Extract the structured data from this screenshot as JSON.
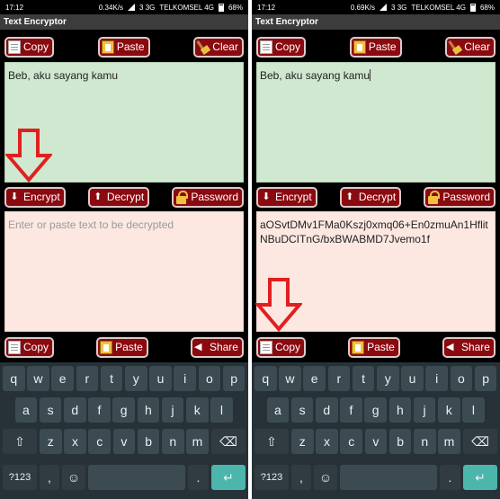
{
  "left": {
    "status": {
      "time": "17:12",
      "speed": "0.34K/s",
      "network": "3 3G",
      "carrier": "TELKOMSEL 4G",
      "battery": "68%"
    },
    "title": "Text Encryptor",
    "top_buttons": {
      "copy": "Copy",
      "paste": "Paste",
      "clear": "Clear"
    },
    "input_text": "Beb, aku sayang kamu",
    "mid_buttons": {
      "encrypt": "Encrypt",
      "decrypt": "Decrypt",
      "password": "Password"
    },
    "output_placeholder": "Enter or paste text to be decrypted",
    "bottom_buttons": {
      "copy": "Copy",
      "paste": "Paste",
      "share": "Share"
    }
  },
  "right": {
    "status": {
      "time": "17:12",
      "speed": "0.69K/s",
      "network": "3 3G",
      "carrier": "TELKOMSEL 4G",
      "battery": "68%"
    },
    "title": "Text Encryptor",
    "top_buttons": {
      "copy": "Copy",
      "paste": "Paste",
      "clear": "Clear"
    },
    "input_text": "Beb, aku sayang kamu",
    "mid_buttons": {
      "encrypt": "Encrypt",
      "decrypt": "Decrypt",
      "password": "Password"
    },
    "output_text": "aOSvtDMv1FMa0Kszj0xmq06+En0zmuAn1HflitNBuDCITnG/bxBWABMD7Jvemo1f",
    "bottom_buttons": {
      "copy": "Copy",
      "paste": "Paste",
      "share": "Share"
    }
  },
  "keyboard": {
    "row1": [
      "q",
      "w",
      "e",
      "r",
      "t",
      "y",
      "u",
      "i",
      "o",
      "p"
    ],
    "row2": [
      "a",
      "s",
      "d",
      "f",
      "g",
      "h",
      "j",
      "k",
      "l"
    ],
    "row3": [
      "z",
      "x",
      "c",
      "v",
      "b",
      "n",
      "m"
    ],
    "sym": "?123",
    "comma": ",",
    "period": "."
  },
  "colors": {
    "button_bg": "#8a0a10",
    "input_bg": "#cfe8cf",
    "output_bg": "#fde8e1",
    "keyboard_bg": "#263238",
    "enter": "#4db6ac",
    "arrow": "#e02020"
  }
}
